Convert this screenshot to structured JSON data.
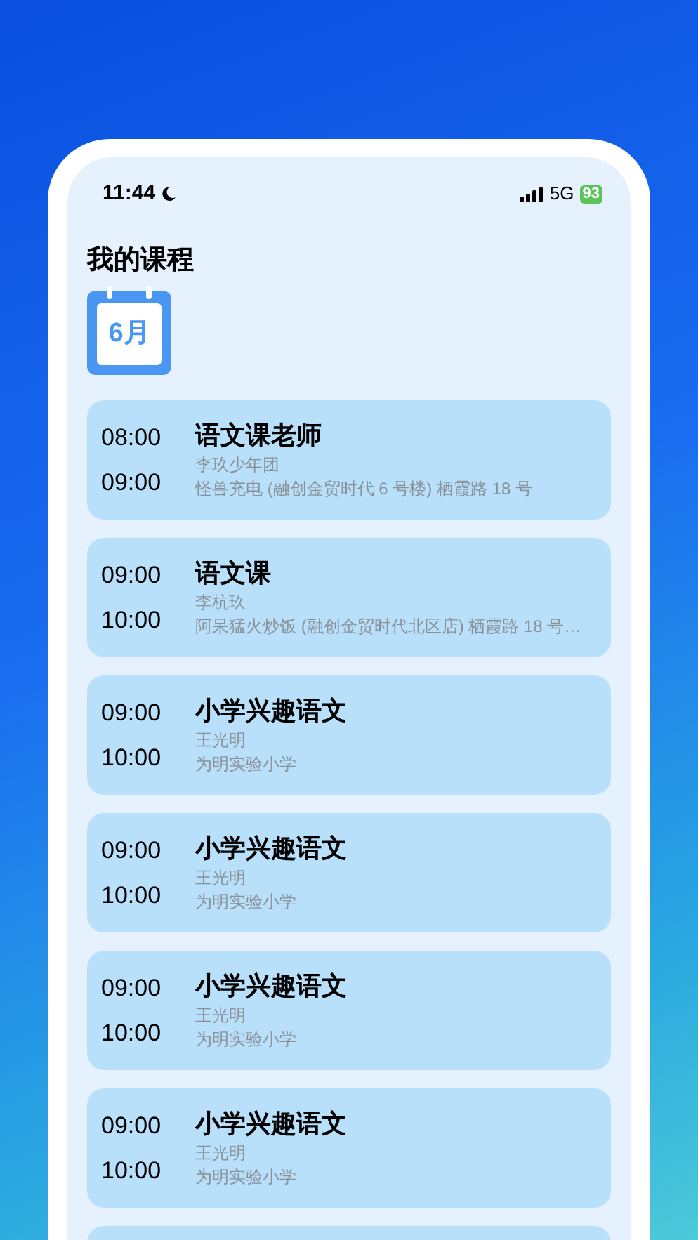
{
  "status_bar": {
    "time": "11:44",
    "network": "5G",
    "battery": "93"
  },
  "title": "我的课程",
  "month_badge": "6月",
  "courses": [
    {
      "start": "08:00",
      "end": "09:00",
      "name": "语文课老师",
      "teacher": "李玖少年团",
      "location": "怪兽充电 (融创金贸时代 6 号楼) 栖霞路 18 号"
    },
    {
      "start": "09:00",
      "end": "10:00",
      "name": "语文课",
      "teacher": "李杭玖",
      "location": "阿呆猛火炒饭 (融创金贸时代北区店) 栖霞路 18 号…"
    },
    {
      "start": "09:00",
      "end": "10:00",
      "name": "小学兴趣语文",
      "teacher": "王光明",
      "location": "为明实验小学"
    },
    {
      "start": "09:00",
      "end": "10:00",
      "name": "小学兴趣语文",
      "teacher": "王光明",
      "location": "为明实验小学"
    },
    {
      "start": "09:00",
      "end": "10:00",
      "name": "小学兴趣语文",
      "teacher": "王光明",
      "location": "为明实验小学"
    },
    {
      "start": "09:00",
      "end": "10:00",
      "name": "小学兴趣语文",
      "teacher": "王光明",
      "location": "为明实验小学"
    }
  ]
}
